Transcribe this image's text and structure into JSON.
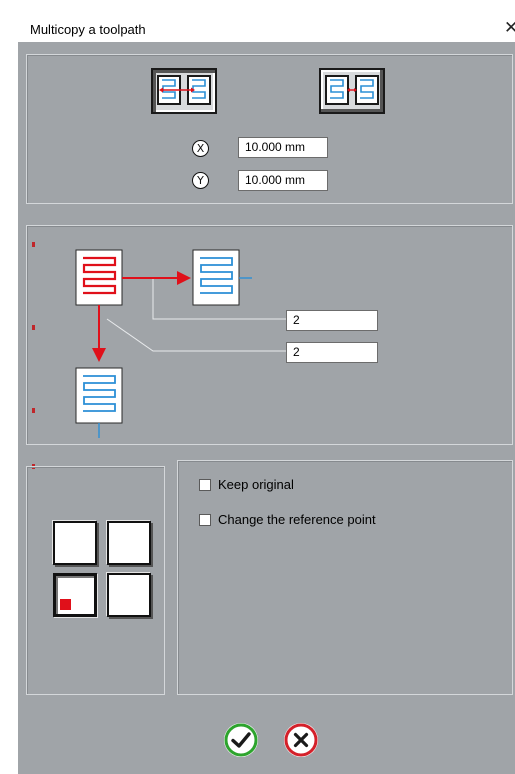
{
  "window": {
    "title": "Multicopy a toolpath",
    "close_glyph": "✕"
  },
  "layout_mode": {
    "buttons": [
      {
        "icon": "copy-spacing-by-distance-icon",
        "selected": true
      },
      {
        "icon": "copy-spacing-by-gap-icon",
        "selected": false
      }
    ]
  },
  "offsets": {
    "x_axis_glyph": "X",
    "x_value": "10.000 mm",
    "y_axis_glyph": "Y",
    "y_value": "10.000 mm"
  },
  "counts": {
    "x_count": "2",
    "y_count": "2"
  },
  "options": {
    "keep_original_label": "Keep original",
    "keep_original_checked": false,
    "change_reference_label": "Change the reference point",
    "change_reference_checked": false
  },
  "reference_point": {
    "selected": "bottom-left"
  },
  "actions": {
    "ok_icon": "check-icon",
    "cancel_icon": "cross-icon"
  },
  "colors": {
    "dialog_bg": "#a0a4a8",
    "original_path": "#e0101a",
    "copy_path": "#2b8fd6",
    "ok_green": "#2da42d",
    "cancel_red": "#d4202a"
  }
}
